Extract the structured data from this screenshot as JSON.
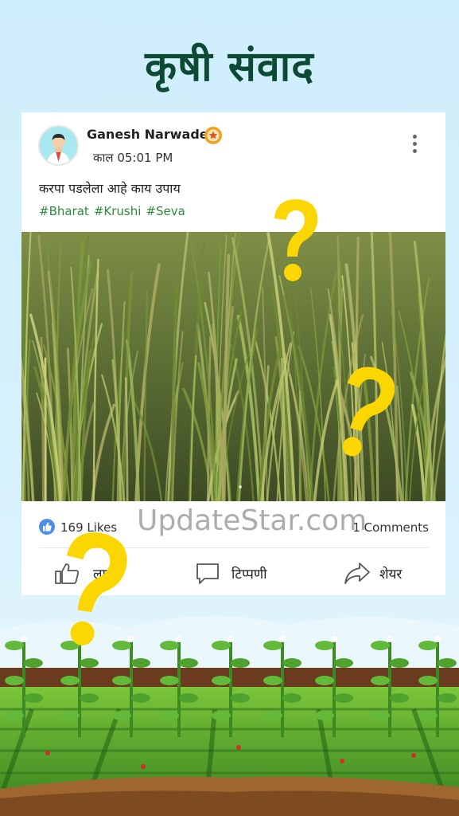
{
  "header": {
    "title": "कृषी संवाद"
  },
  "post": {
    "author": "Ganesh Narwade",
    "time": "काल 05:01 PM",
    "text": "करपा पडलेला आहे काय उपाय",
    "hashtags": [
      "#Bharat",
      "#Krushi",
      "#Seva"
    ],
    "likes": "169 Likes",
    "comments": "1 Comments",
    "actions": {
      "like": "लाइक",
      "comment": "टिप्पणी",
      "share": "शेयर"
    }
  },
  "watermark": "UpdateStar.com",
  "icons": [
    "avatar",
    "badge-icon",
    "more-options-icon",
    "like-count-icon",
    "like-icon",
    "comment-icon",
    "share-icon",
    "question-mark-icon"
  ],
  "colors": {
    "title": "#0c4a34",
    "hashtag": "#2e8b3e",
    "like_blue": "#4e8ee8",
    "question": "#fcd600"
  }
}
